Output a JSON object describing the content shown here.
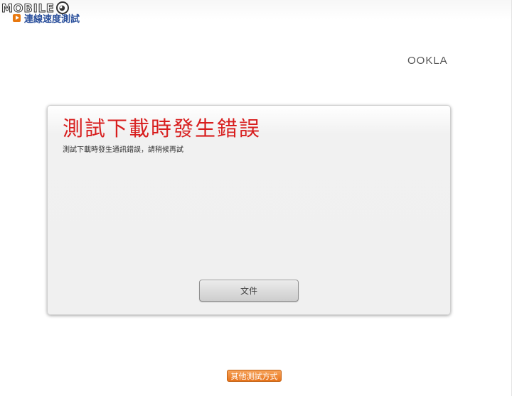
{
  "watermark": {
    "text": "MOBILE",
    "face": "◕"
  },
  "header": {
    "title": "連線速度測試",
    "icon": "play-icon"
  },
  "brand": {
    "logo": "OOKLA",
    "accent": "#e8780f"
  },
  "dialog": {
    "title": "測試下載時發生錯誤",
    "message": "測試下載時發生通訊錯誤，請稍候再試",
    "button_label": "文件"
  },
  "footer": {
    "other_methods_label": "其他測試方式"
  },
  "colors": {
    "title_red": "#d81e1e",
    "header_blue": "#2a4f9b",
    "orange": "#e8780f"
  }
}
